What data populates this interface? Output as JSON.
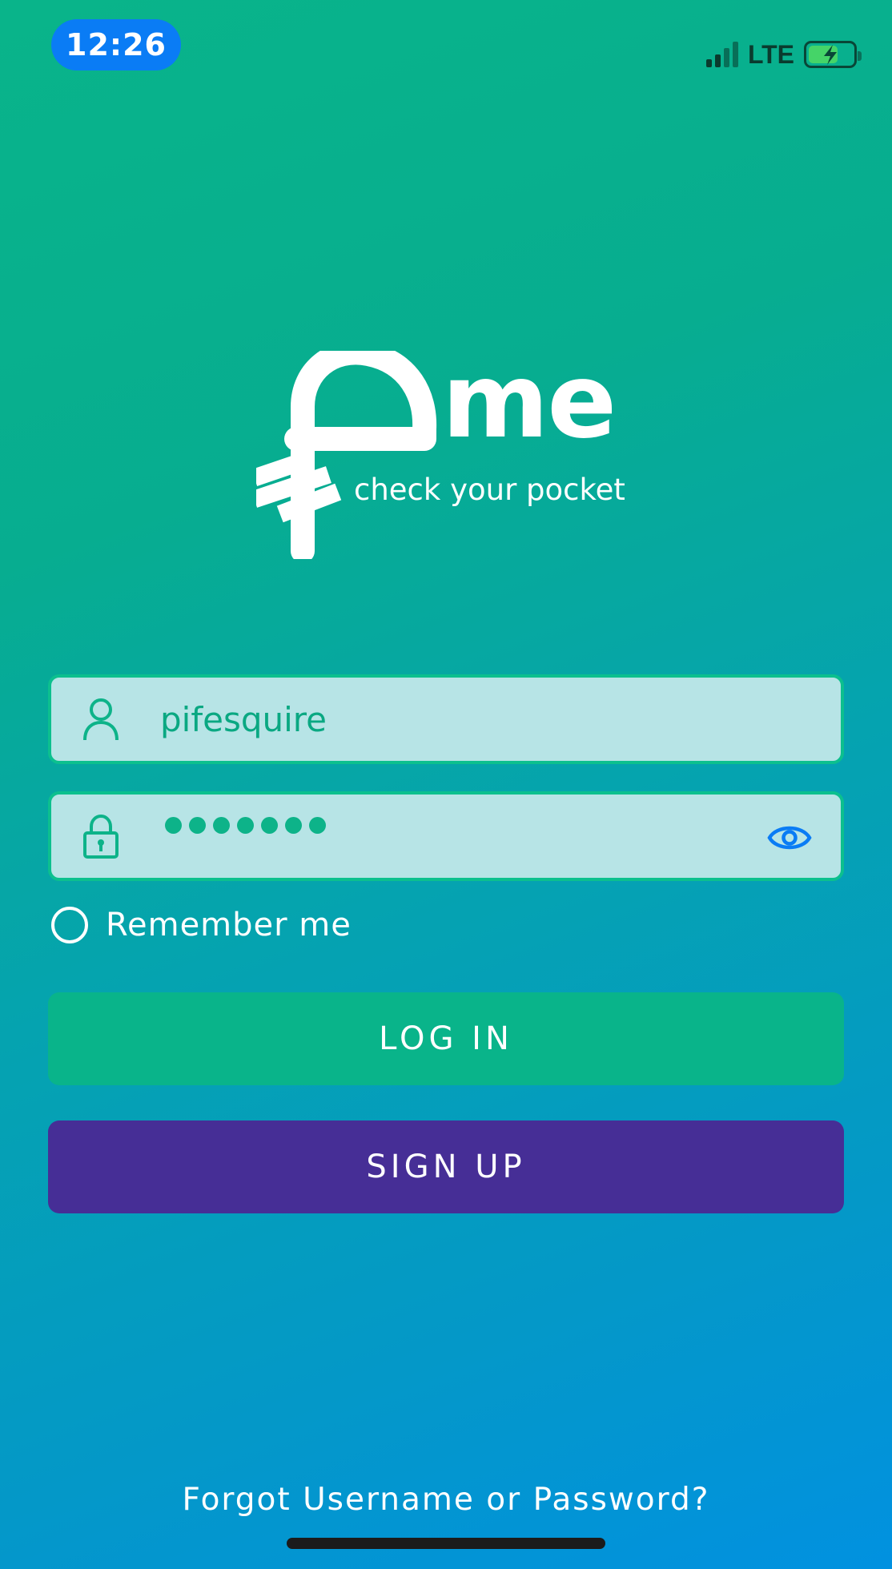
{
  "status_bar": {
    "time": "12:26",
    "network": "LTE",
    "battery_level": 0.7,
    "battery_charging": true
  },
  "logo": {
    "wordmark": "me",
    "tagline": "check your pocket"
  },
  "login_form": {
    "username": {
      "value": "pifesquire",
      "icon": "user-icon"
    },
    "password": {
      "masked_length": 7,
      "icon": "lock-icon",
      "toggle_icon": "eye-icon"
    },
    "remember_me": {
      "label": "Remember me",
      "checked": false
    },
    "login_button": "LOG IN",
    "signup_button": "SIGN UP",
    "forgot_link": "Forgot Username or Password?"
  },
  "colors": {
    "accent_green": "#09b48a",
    "signup_purple": "#462e96",
    "field_bg": "#b7e4e6",
    "eye_blue": "#0a7cf5"
  }
}
